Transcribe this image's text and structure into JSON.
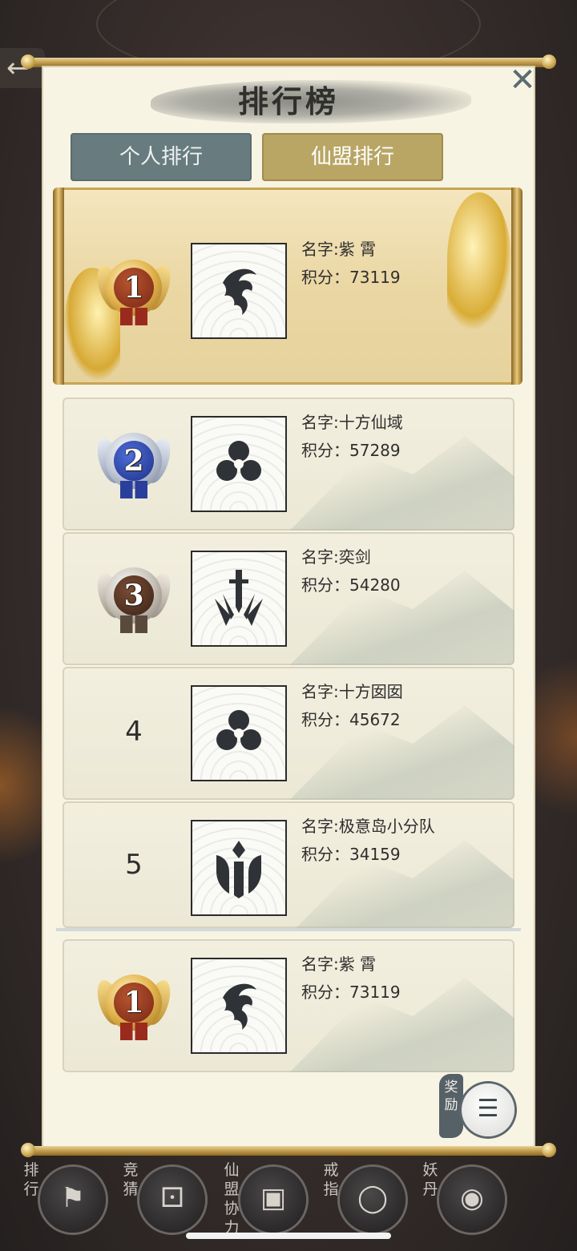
{
  "header": {
    "title": "排行榜",
    "back_icon": "back-arrow-icon",
    "close_icon": "close-icon",
    "close_symbol": "✕"
  },
  "tabs": [
    {
      "label": "个人排行",
      "selected": false
    },
    {
      "label": "仙盟排行",
      "selected": true
    }
  ],
  "ranking": [
    {
      "rank": "1",
      "badge": "gold",
      "emblem": "dragon-emblem-icon",
      "name": "名字:紫  霄",
      "score": "积分：73119"
    },
    {
      "rank": "2",
      "badge": "blue",
      "emblem": "flower-emblem-icon",
      "name": "名字:十方仙域",
      "score": "积分：57289"
    },
    {
      "rank": "3",
      "badge": "silver",
      "emblem": "sword-emblem-icon",
      "name": "名字:奕剑",
      "score": "积分：54280"
    },
    {
      "rank": "4",
      "badge": "none",
      "emblem": "flower-emblem-icon",
      "name": "名字:十方囡囡",
      "score": "积分：45672"
    },
    {
      "rank": "5",
      "badge": "none",
      "emblem": "crest-emblem-icon",
      "name": "名字:极意岛小分队",
      "score": "积分：34159"
    }
  ],
  "my_rank": {
    "rank": "1",
    "badge": "gold",
    "emblem": "dragon-emblem-icon",
    "name": "名字:紫  霄",
    "score": "积分：73119"
  },
  "reward": {
    "label": "奖励",
    "icon": "treasure-chest-icon"
  },
  "bottom_nav": [
    {
      "label": "排行",
      "icon": "banner-icon",
      "glyph": "⚑"
    },
    {
      "label": "竞猜",
      "icon": "dice-icon",
      "glyph": "⚀"
    },
    {
      "label": "仙盟协力",
      "icon": "chest-icon",
      "glyph": "▣"
    },
    {
      "label": "戒指",
      "icon": "ring-icon",
      "glyph": "◯"
    },
    {
      "label": "妖丹",
      "icon": "orb-icon",
      "glyph": "◉"
    }
  ],
  "colors": {
    "panel_bg": "#f8f4e3",
    "tab_inactive": "#687c80",
    "tab_active": "#b9a665",
    "first_row_bg": "#ead7a4",
    "text": "#2e2e2e"
  }
}
